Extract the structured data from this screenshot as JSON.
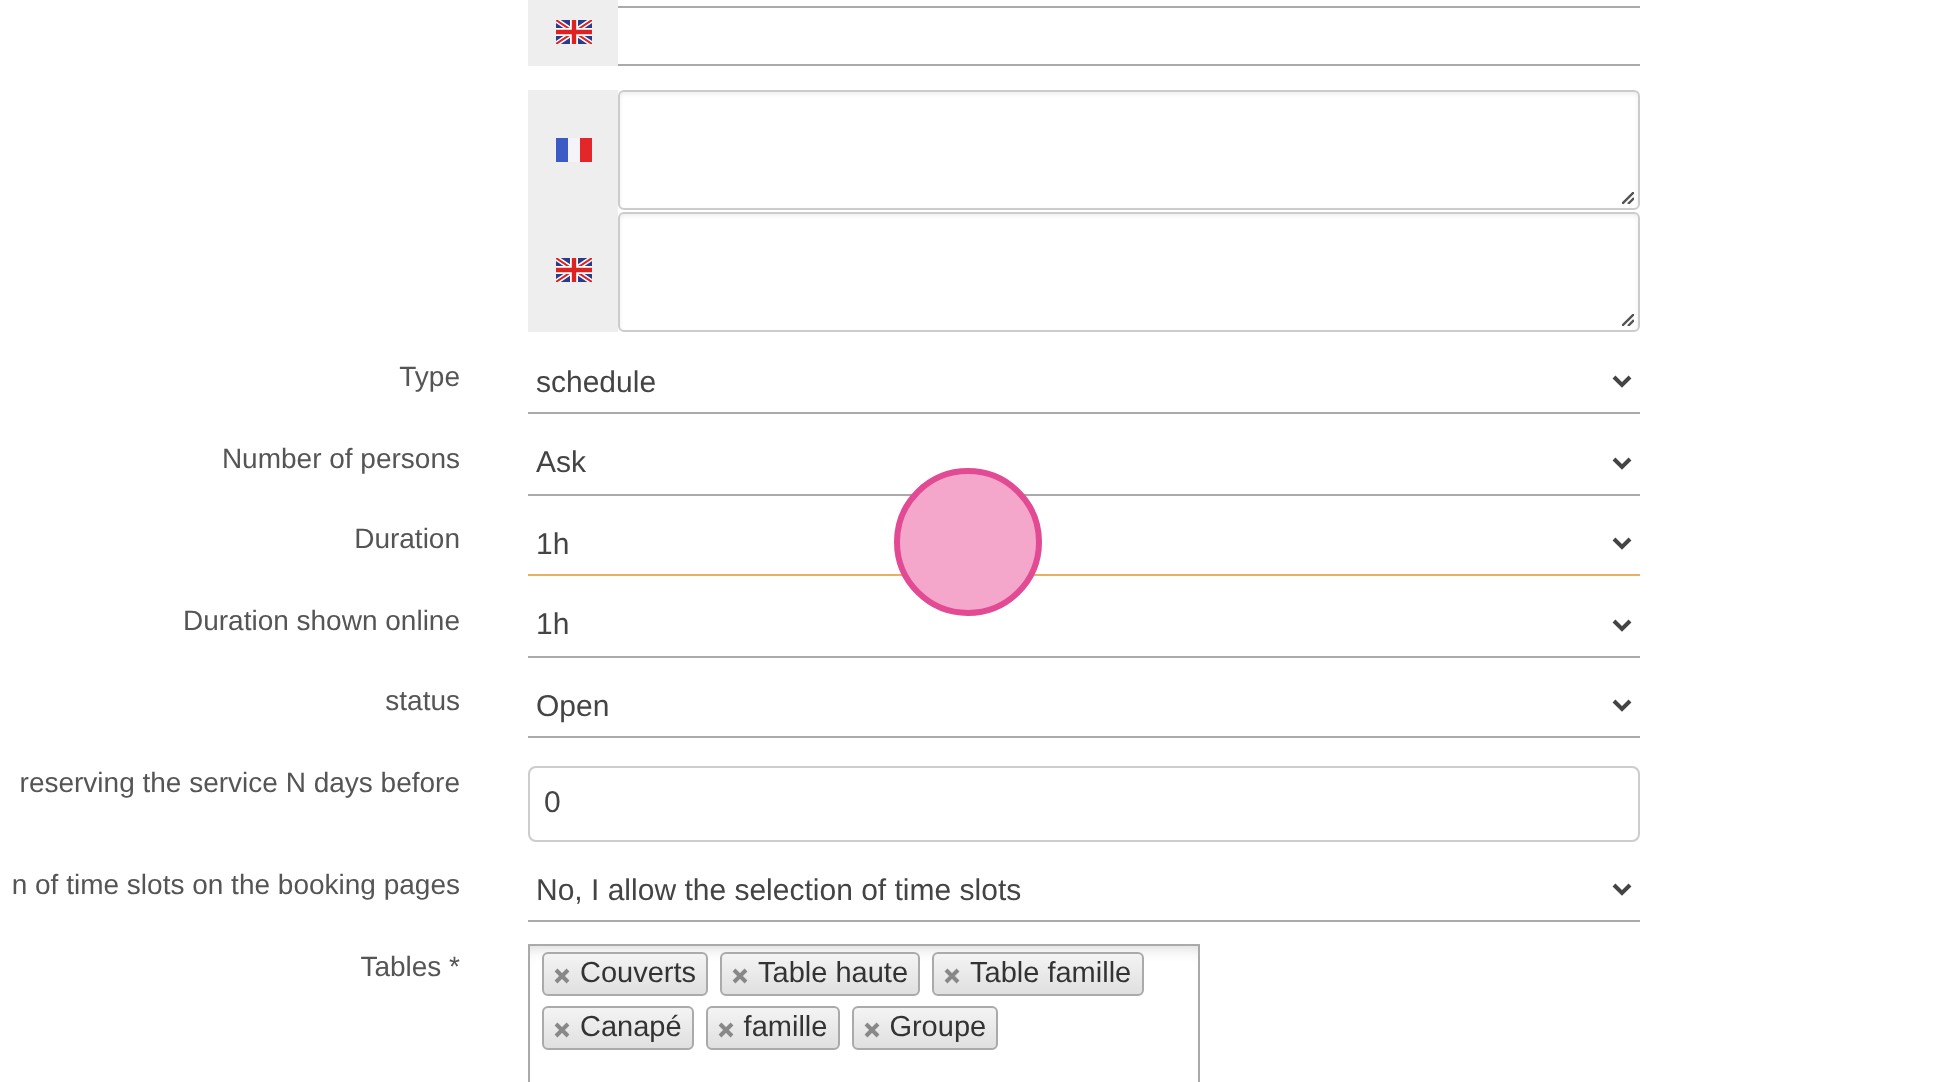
{
  "text_fields": [
    {
      "kind": "gb"
    }
  ],
  "text_areas": [
    {
      "kind": "fr"
    },
    {
      "kind": "gb"
    }
  ],
  "fields": [
    {
      "label": "Type",
      "kind": "select",
      "value": "schedule",
      "focused": false
    },
    {
      "label": "Number of persons",
      "kind": "select",
      "value": "Ask",
      "focused": false
    },
    {
      "label": "Duration",
      "kind": "select",
      "value": "1h",
      "focused": true
    },
    {
      "label": "Duration shown online",
      "kind": "select",
      "value": "1h",
      "focused": false
    },
    {
      "label": "status",
      "kind": "select",
      "value": "Open",
      "focused": false
    },
    {
      "label": "reserving the service N days before",
      "kind": "number",
      "value": "0",
      "focused": false
    },
    {
      "label": "n of time slots on the booking pages",
      "kind": "select",
      "value": "No, I allow the selection of time slots",
      "focused": false
    },
    {
      "label": "Tables *",
      "kind": "tags",
      "tags": [
        "Couverts",
        "Table haute",
        "Table famille",
        "Canapé",
        "famille",
        "Groupe"
      ],
      "focused": false
    }
  ],
  "click_highlight": true
}
